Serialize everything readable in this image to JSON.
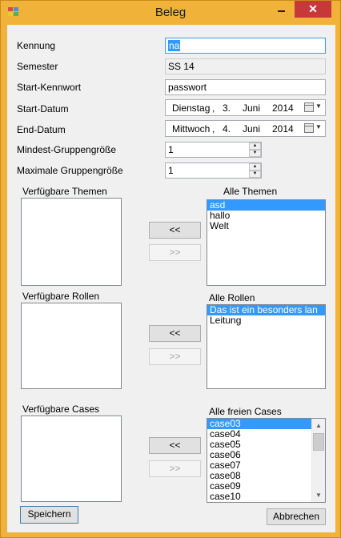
{
  "window": {
    "title": "Beleg",
    "close_glyph": "✕"
  },
  "form": {
    "kennung_label": "Kennung",
    "kennung_value": "na",
    "semester_label": "Semester",
    "semester_value": "SS 14",
    "start_kennwort_label": "Start-Kennwort",
    "start_kennwort_value": "passwort",
    "start_datum_label": "Start-Datum",
    "start_datum": {
      "weekday": "Dienstag",
      "day": "3.",
      "month": "Juni",
      "year": "2014"
    },
    "end_datum_label": "End-Datum",
    "end_datum": {
      "weekday": "Mittwoch",
      "day": "4.",
      "month": "Juni",
      "year": "2014"
    },
    "mindest_label": "Mindest-Gruppengröße",
    "mindest_value": "1",
    "maximale_label": "Maximale Gruppengröße",
    "maximale_value": "1"
  },
  "themen": {
    "available_label": "Verfügbare Themen",
    "all_label": "Alle Themen",
    "available": [],
    "all": [
      "asd",
      "hallo",
      "Welt"
    ],
    "selected_index": 0
  },
  "rollen": {
    "available_label": "Verfügbare Rollen",
    "all_label": "Alle Rollen",
    "available": [],
    "all": [
      "Das ist ein besonders lan",
      "Leitung"
    ],
    "selected_index": 0
  },
  "cases": {
    "available_label": "Verfügbare Cases",
    "all_label": "Alle freien Cases",
    "available": [],
    "all": [
      "case03",
      "case04",
      "case05",
      "case06",
      "case07",
      "case08",
      "case09",
      "case10"
    ],
    "selected_index": 0
  },
  "buttons": {
    "move_left": "<<",
    "move_right": ">>",
    "save": "Speichern",
    "cancel": "Abbrechen",
    "spin_up": "▲",
    "spin_down": "▼",
    "dropdown": "▼",
    "scroll_up": "▲",
    "scroll_down": "▼"
  },
  "colors": {
    "title_bar": "#f0b239",
    "selection": "#3399ff",
    "close_button": "#c7383a"
  }
}
